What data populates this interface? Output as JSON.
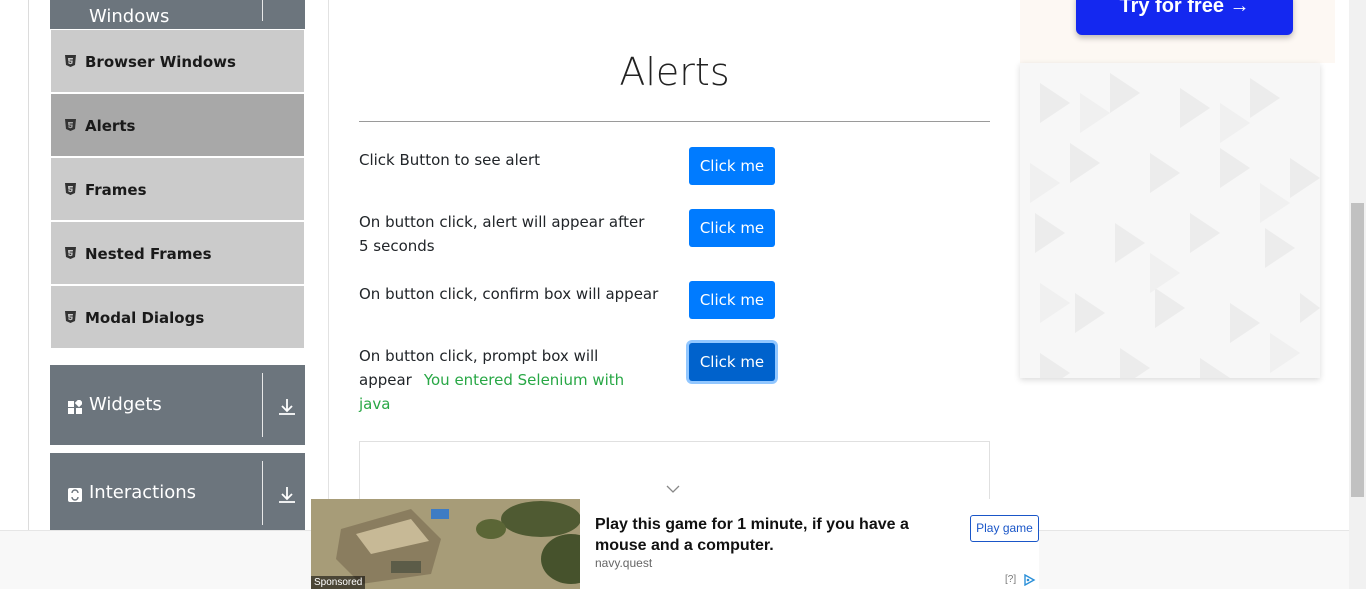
{
  "sidebar": {
    "group_top": {
      "title": "Windows"
    },
    "items": [
      {
        "label": "Browser Windows",
        "active": false
      },
      {
        "label": "Alerts",
        "active": true
      },
      {
        "label": "Frames",
        "active": false
      },
      {
        "label": "Nested Frames",
        "active": false
      },
      {
        "label": "Modal Dialogs",
        "active": false
      }
    ],
    "groups": [
      {
        "title": "Widgets",
        "icon": "widgets-icon"
      },
      {
        "title": "Interactions",
        "icon": "interactions-icon"
      }
    ]
  },
  "main": {
    "title": "Alerts",
    "rows": [
      {
        "label": "Click Button to see alert",
        "button": "Click me"
      },
      {
        "label": "On button click, alert will appear after 5 seconds",
        "button": "Click me"
      },
      {
        "label": "On button click, confirm box will appear",
        "button": "Click me"
      },
      {
        "label": "On button click, prompt box will appear",
        "button": "Click me",
        "result": "You entered Selenium with java"
      }
    ]
  },
  "ad_side": {
    "cta": "Try for free →"
  },
  "ad_bottom": {
    "sponsored": "Sponsored",
    "headline": "Play this game for 1 minute, if you have a mouse and a computer.",
    "domain": "navy.quest",
    "cta": "Play game",
    "help": "[?]"
  },
  "colors": {
    "primary": "#007bff",
    "success": "#28a745",
    "sidebar_header": "#6c757d",
    "menu_item": "#cbcbcb",
    "menu_active": "#a8a8a8"
  }
}
